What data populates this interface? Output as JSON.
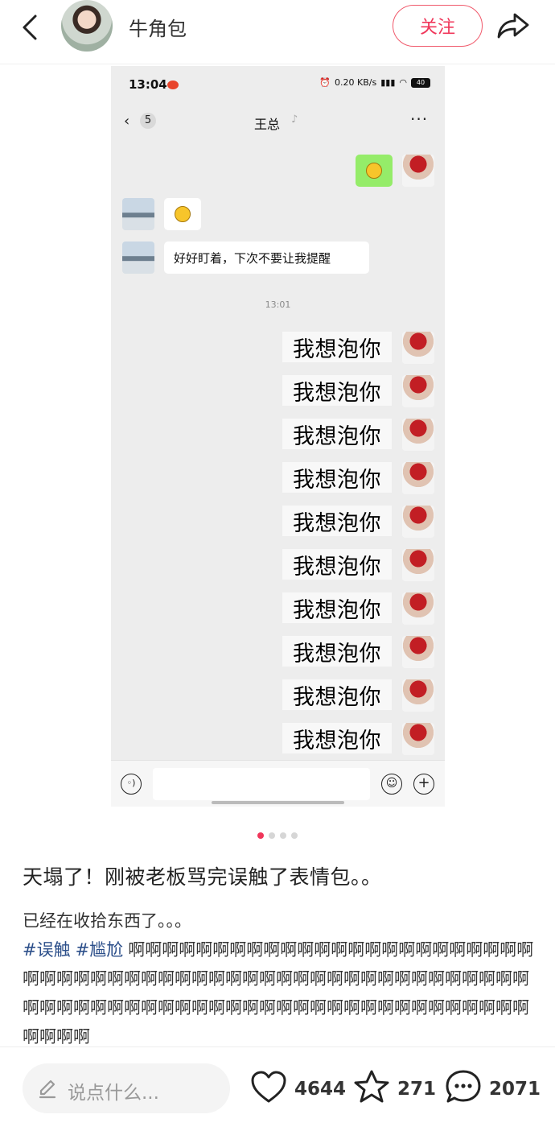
{
  "header": {
    "author_name": "牛角包",
    "follow_label": "关注"
  },
  "screenshot": {
    "status_time": "13:04",
    "network_speed": "0.20 KB/s",
    "battery": "40",
    "chat_unread_count": "5",
    "chat_name": "王总",
    "more_label": "···",
    "message_text": "好好盯着，下次不要让我提醒",
    "timestamp": "13:01",
    "stamp_text": "我想泡你",
    "stamps": [
      "我想泡你",
      "我想泡你",
      "我想泡你",
      "我想泡你",
      "我想泡你",
      "我想泡你",
      "我想泡你",
      "我想泡你",
      "我想泡你",
      "我想泡你"
    ]
  },
  "carousel": {
    "total": 4,
    "active_index": 0
  },
  "post": {
    "title": "天塌了！刚被老板骂完误触了表情包。。",
    "body": "已经在收拾东西了。。。",
    "tags": [
      "#误触",
      "#尴尬"
    ],
    "tail_text": "啊啊啊啊啊啊啊啊啊啊啊啊啊啊啊啊啊啊啊啊啊啊啊啊啊啊啊啊啊啊啊啊啊啊啊啊啊啊啊啊啊啊啊啊啊啊啊啊啊啊啊啊啊啊啊啊啊啊啊啊啊啊啊啊啊啊啊啊啊啊啊啊啊啊啊啊啊啊啊啊啊啊啊啊啊啊啊啊"
  },
  "bottom": {
    "comment_placeholder": "说点什么...",
    "likes": "4644",
    "collects": "271",
    "comments": "2071"
  },
  "colors": {
    "accent": "#f0365a",
    "tag": "#2c4f8a",
    "wechat_green": "#95ec69"
  }
}
